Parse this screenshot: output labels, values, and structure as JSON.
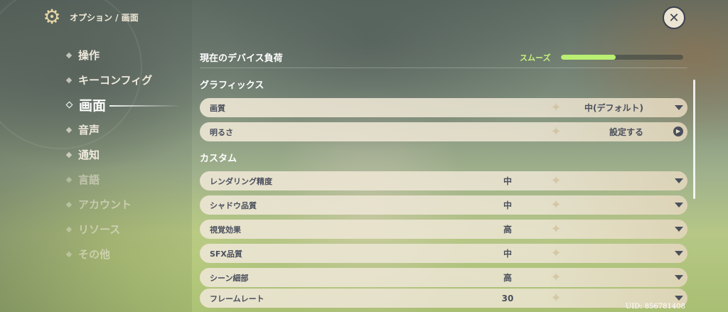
{
  "header": {
    "breadcrumb": "オプション / 画面",
    "gear_icon": "gear-icon",
    "close_icon": "close-icon"
  },
  "sidebar": {
    "items": [
      {
        "label": "操作",
        "state": "normal"
      },
      {
        "label": "キーコンフィグ",
        "state": "normal"
      },
      {
        "label": "画面",
        "state": "active"
      },
      {
        "label": "音声",
        "state": "normal"
      },
      {
        "label": "通知",
        "state": "normal"
      },
      {
        "label": "言語",
        "state": "dim"
      },
      {
        "label": "アカウント",
        "state": "dim"
      },
      {
        "label": "リソース",
        "state": "dim"
      },
      {
        "label": "その他",
        "state": "dim"
      }
    ]
  },
  "device_load": {
    "label": "現在のデバイス負荷",
    "status": "スムーズ",
    "level_fraction": 0.45,
    "status_color": "#c7f27e"
  },
  "graphics": {
    "title": "グラフィックス",
    "rows": [
      {
        "label": "画質",
        "value": "中(デフォルト)",
        "control": "dropdown"
      },
      {
        "label": "明るさ",
        "value": "設定する",
        "control": "link"
      }
    ]
  },
  "custom": {
    "title": "カスタム",
    "rows": [
      {
        "label": "レンダリング精度",
        "value": "中",
        "control": "dropdown"
      },
      {
        "label": "シャドウ品質",
        "value": "中",
        "control": "dropdown"
      },
      {
        "label": "視覚効果",
        "value": "高",
        "control": "dropdown"
      },
      {
        "label": "SFX品質",
        "value": "中",
        "control": "dropdown"
      },
      {
        "label": "シーン細部",
        "value": "高",
        "control": "dropdown"
      },
      {
        "label": "フレームレート",
        "value": "30",
        "control": "dropdown"
      }
    ]
  },
  "uid": "UID: 856781408"
}
